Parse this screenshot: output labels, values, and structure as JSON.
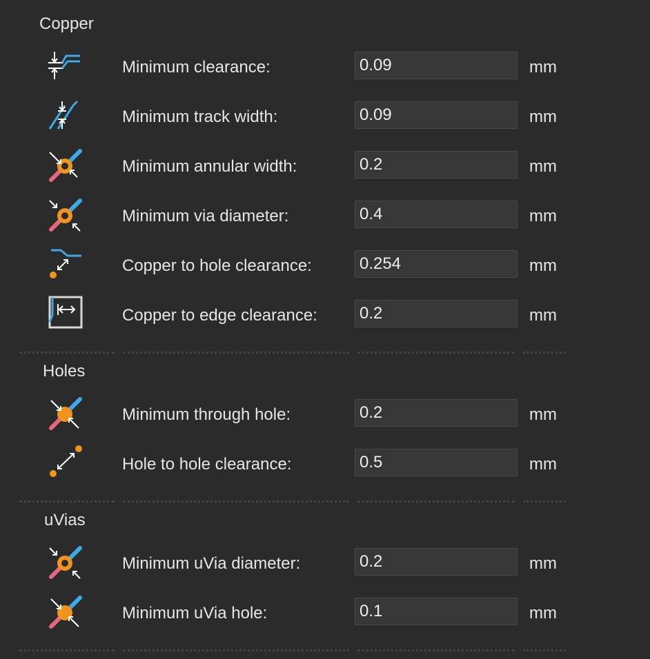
{
  "sections": {
    "copper": {
      "title": "Copper",
      "rows": [
        {
          "label": "Minimum clearance:",
          "value": "0.09",
          "unit": "mm",
          "icon": "clearance-icon"
        },
        {
          "label": "Minimum track width:",
          "value": "0.09",
          "unit": "mm",
          "icon": "track-width-icon"
        },
        {
          "label": "Minimum annular width:",
          "value": "0.2",
          "unit": "mm",
          "icon": "annular-width-icon"
        },
        {
          "label": "Minimum via diameter:",
          "value": "0.4",
          "unit": "mm",
          "icon": "via-diameter-icon"
        },
        {
          "label": "Copper to hole clearance:",
          "value": "0.254",
          "unit": "mm",
          "icon": "copper-hole-clearance-icon"
        },
        {
          "label": "Copper to edge clearance:",
          "value": "0.2",
          "unit": "mm",
          "icon": "copper-edge-clearance-icon"
        }
      ]
    },
    "holes": {
      "title": "Holes",
      "rows": [
        {
          "label": "Minimum through hole:",
          "value": "0.2",
          "unit": "mm",
          "icon": "through-hole-icon"
        },
        {
          "label": "Hole to hole clearance:",
          "value": "0.5",
          "unit": "mm",
          "icon": "hole-to-hole-icon"
        }
      ]
    },
    "uvias": {
      "title": "uVias",
      "rows": [
        {
          "label": "Minimum uVia diameter:",
          "value": "0.2",
          "unit": "mm",
          "icon": "uvia-diameter-icon"
        },
        {
          "label": "Minimum uVia hole:",
          "value": "0.1",
          "unit": "mm",
          "icon": "uvia-hole-icon"
        }
      ]
    }
  },
  "colors": {
    "background": "#2b2b2b",
    "field_background": "#373737",
    "copper_blue": "#3fa9e8",
    "orange": "#f0941f",
    "pink": "#e8677f"
  }
}
